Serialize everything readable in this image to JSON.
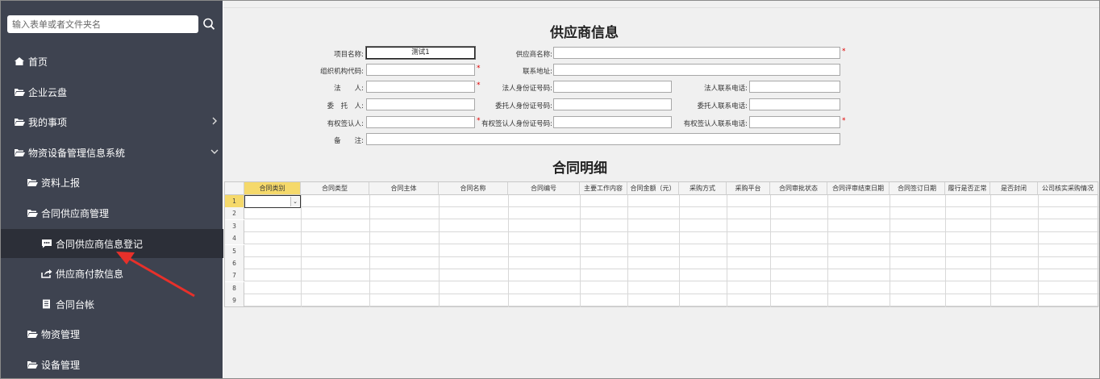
{
  "sidebar": {
    "search_placeholder": "输入表单或者文件夹名",
    "items": [
      {
        "label": "首页"
      },
      {
        "label": "企业云盘"
      },
      {
        "label": "我的事项"
      },
      {
        "label": "物资设备管理信息系统"
      },
      {
        "label": "资料上报"
      },
      {
        "label": "合同供应商管理"
      },
      {
        "label": "合同供应商信息登记"
      },
      {
        "label": "供应商付款信息"
      },
      {
        "label": "合同台帐"
      },
      {
        "label": "物资管理"
      },
      {
        "label": "设备管理"
      }
    ]
  },
  "form": {
    "title": "供应商信息",
    "labels": {
      "project_name": "项目名称:",
      "supplier_name": "供应商名称:",
      "org_code": "组织机构代码:",
      "address": "联系地址:",
      "legal_person": "法　　人:",
      "legal_id": "法人身份证号码:",
      "legal_phone": "法人联系电话:",
      "delegate": "委　托　人:",
      "delegate_id": "委托人身份证号码:",
      "delegate_phone": "委托人联系电话:",
      "signer": "有权签认人:",
      "signer_id": "有权签认人身份证号码:",
      "signer_phone": "有权签认人联系电话:",
      "remark": "备　　注:"
    },
    "values": {
      "project_name": "测试1"
    },
    "required_mark": "*"
  },
  "detail": {
    "title": "合同明细",
    "columns": [
      "合同类别",
      "合同类型",
      "合同主体",
      "合同名称",
      "合同编号",
      "主要工作内容",
      "合同金额（元）",
      "采购方式",
      "采购平台",
      "合同审批状态",
      "合同评审结束日期",
      "合同签订日期",
      "履行是否正常",
      "是否封闭",
      "公司核实采购情况"
    ],
    "rows": [
      "1",
      "2",
      "3",
      "4",
      "5",
      "6",
      "7",
      "8",
      "9"
    ]
  },
  "colors": {
    "sidebar_bg": "#3e4350",
    "highlight": "#f5d96b",
    "required": "#e00000",
    "arrow": "#e8302a"
  }
}
